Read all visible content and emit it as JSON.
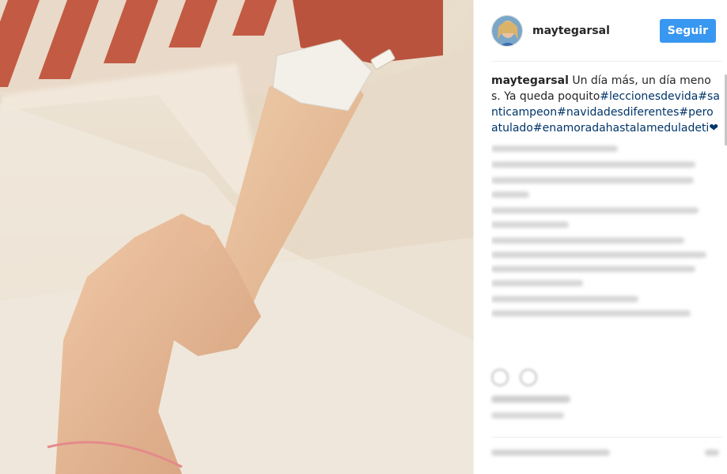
{
  "post": {
    "photo_description_icon": "photo",
    "author": {
      "username": "maytegarsal",
      "follow_label": "Seguir",
      "follow_color": "#3897f0"
    },
    "caption": {
      "username": "maytegarsal",
      "text": " Un día más, un día menos. Ya queda poquito",
      "hashtags": [
        "#leccionesdevida",
        "#santicampeon",
        "#navidadesdiferentes",
        "#peroatulado",
        "#enamoradahastalameduladeti"
      ],
      "emoji": "❤"
    },
    "colors": {
      "link": "#003569",
      "text": "#262626"
    }
  }
}
